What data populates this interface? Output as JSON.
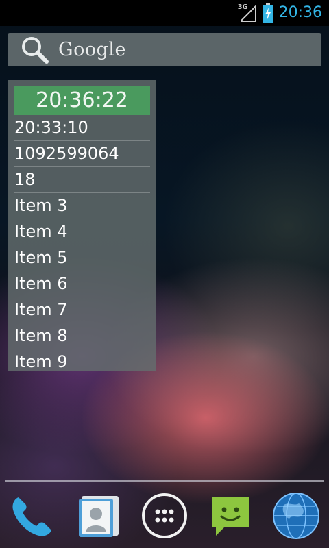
{
  "status_bar": {
    "network_type": "3G",
    "time": "20:36"
  },
  "search": {
    "label": "Google"
  },
  "widget": {
    "header_time": "20:36:22",
    "items": [
      "20:33:10",
      "1092599064",
      "18",
      "Item 3",
      "Item 4",
      "Item 5",
      "Item 6",
      "Item 7",
      "Item 8",
      "Item 9"
    ],
    "header_color": "#4a9a5e"
  },
  "dock": {
    "apps": [
      {
        "icon": "phone-icon"
      },
      {
        "icon": "contacts-icon"
      },
      {
        "icon": "app-drawer-icon"
      },
      {
        "icon": "messaging-icon"
      },
      {
        "icon": "browser-globe-icon"
      }
    ]
  },
  "colors": {
    "status_clock": "#33b5e5"
  }
}
